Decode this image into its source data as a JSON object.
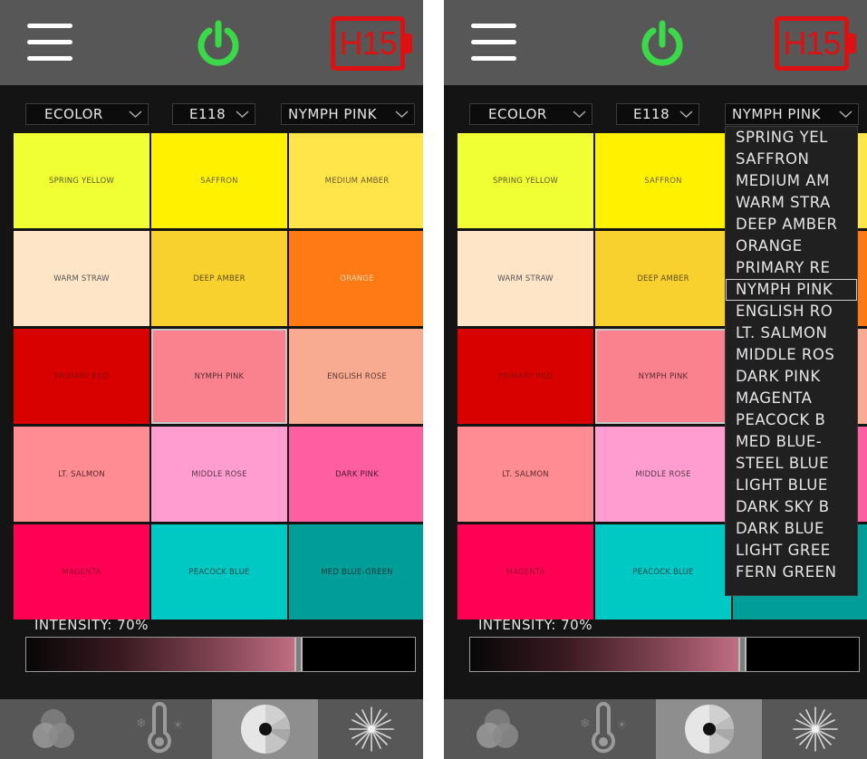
{
  "header": {
    "battery_label": "H15"
  },
  "selectors": {
    "type": "ECOLOR",
    "code": "E118",
    "color": "NYMPH PINK"
  },
  "swatches": [
    {
      "label": "SPRING YELLOW",
      "color": "#EFFF34",
      "text_color": "#5a5a20"
    },
    {
      "label": "SAFFRON",
      "color": "#FFF100",
      "text_color": "#6a6020"
    },
    {
      "label": "MEDIUM AMBER",
      "color": "#FFE54A",
      "text_color": "#6a5a30"
    },
    {
      "label": "WARM STRAW",
      "color": "#FFE5C7",
      "text_color": "#555555"
    },
    {
      "label": "DEEP AMBER",
      "color": "#F9D12F",
      "text_color": "#5e4f1a"
    },
    {
      "label": "ORANGE",
      "color": "#FF7A14",
      "text_color": "#ffd8b0"
    },
    {
      "label": "PRIMARY RED",
      "color": "#D90000",
      "text_color": "#8a1010"
    },
    {
      "label": "NYMPH PINK",
      "color": "#F9828E",
      "text_color": "#5a2a30"
    },
    {
      "label": "ENGLISH ROSE",
      "color": "#F9AB92",
      "text_color": "#5a3a30"
    },
    {
      "label": "LT. SALMON",
      "color": "#FF8C92",
      "text_color": "#5a2a30"
    },
    {
      "label": "MIDDLE ROSE",
      "color": "#FF9DD0",
      "text_color": "#5a3a4a"
    },
    {
      "label": "DARK PINK",
      "color": "#FF5EA0",
      "text_color": "#4a1a30"
    },
    {
      "label": "MAGENTA",
      "color": "#FF0055",
      "text_color": "#9a0030"
    },
    {
      "label": "PEACOCK BLUE",
      "color": "#00C8C3",
      "text_color": "#0a4a4a"
    },
    {
      "label": "MED BLUE-GREEN",
      "color": "#009D99",
      "text_color": "#0a3a38"
    }
  ],
  "selected_swatch": "NYMPH PINK",
  "intensity": {
    "label": "INTENSITY: 70%",
    "value": 0.7
  },
  "tabs": [
    {
      "name": "color-mix",
      "active": false
    },
    {
      "name": "temperature",
      "active": false
    },
    {
      "name": "gel-wheel",
      "active": true
    },
    {
      "name": "effects",
      "active": false
    }
  ],
  "dropdown_list": {
    "items": [
      "SPRING YEL",
      "SAFFRON",
      "MEDIUM AM",
      "WARM STRA",
      "DEEP AMBER",
      "ORANGE",
      "PRIMARY RE",
      "NYMPH PINK",
      "ENGLISH RO",
      "LT. SALMON",
      "MIDDLE ROS",
      "DARK PINK",
      "MAGENTA",
      "PEACOCK B",
      "MED BLUE-",
      "STEEL BLUE",
      "LIGHT BLUE",
      "DARK SKY B",
      "DARK BLUE",
      "LIGHT GREE",
      "FERN GREEN"
    ],
    "selected": "NYMPH PINK"
  },
  "colors": {
    "header_bg": "#575757",
    "app_bg": "#141414",
    "power_green": "#3BD94A",
    "battery_red": "#DD1111",
    "active_tab": "#8E8E8E"
  }
}
